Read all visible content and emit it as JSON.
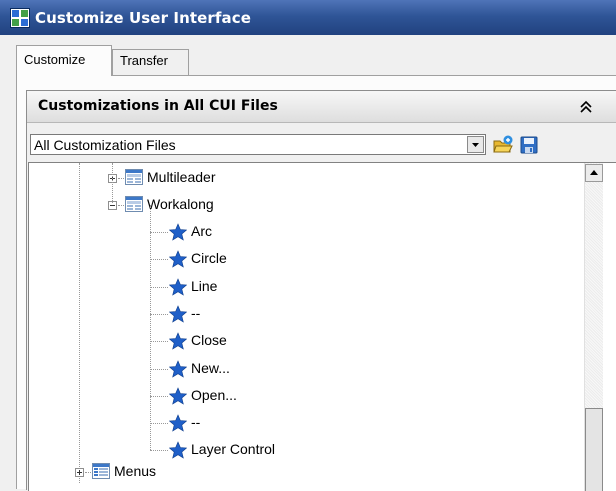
{
  "window": {
    "title": "Customize User Interface"
  },
  "tabs": [
    {
      "label": "Customize"
    },
    {
      "label": "Transfer"
    }
  ],
  "panel": {
    "title": "Customizations in All CUI Files",
    "file_filter": {
      "selected": "All Customization Files"
    }
  },
  "tree": {
    "toolbars": [
      {
        "label": "Multileader",
        "expanded": false
      },
      {
        "label": "Workalong",
        "expanded": true,
        "commands": [
          "Arc",
          "Circle",
          "Line",
          "--",
          "Close",
          "New...",
          "Open...",
          "--",
          "Layer Control"
        ]
      }
    ],
    "menus": {
      "label": "Menus",
      "expanded": false
    }
  },
  "icons": {
    "title": "cui-app-icon",
    "toolbar": "toolbar-icon",
    "command": "star-command-icon",
    "menu": "menu-icon",
    "load": "open-folder-icon",
    "save": "save-disk-icon",
    "collapse": "double-chevron-up-icon"
  },
  "colors": {
    "titlebar": "#2f5597",
    "star": "#1f5fc8"
  }
}
